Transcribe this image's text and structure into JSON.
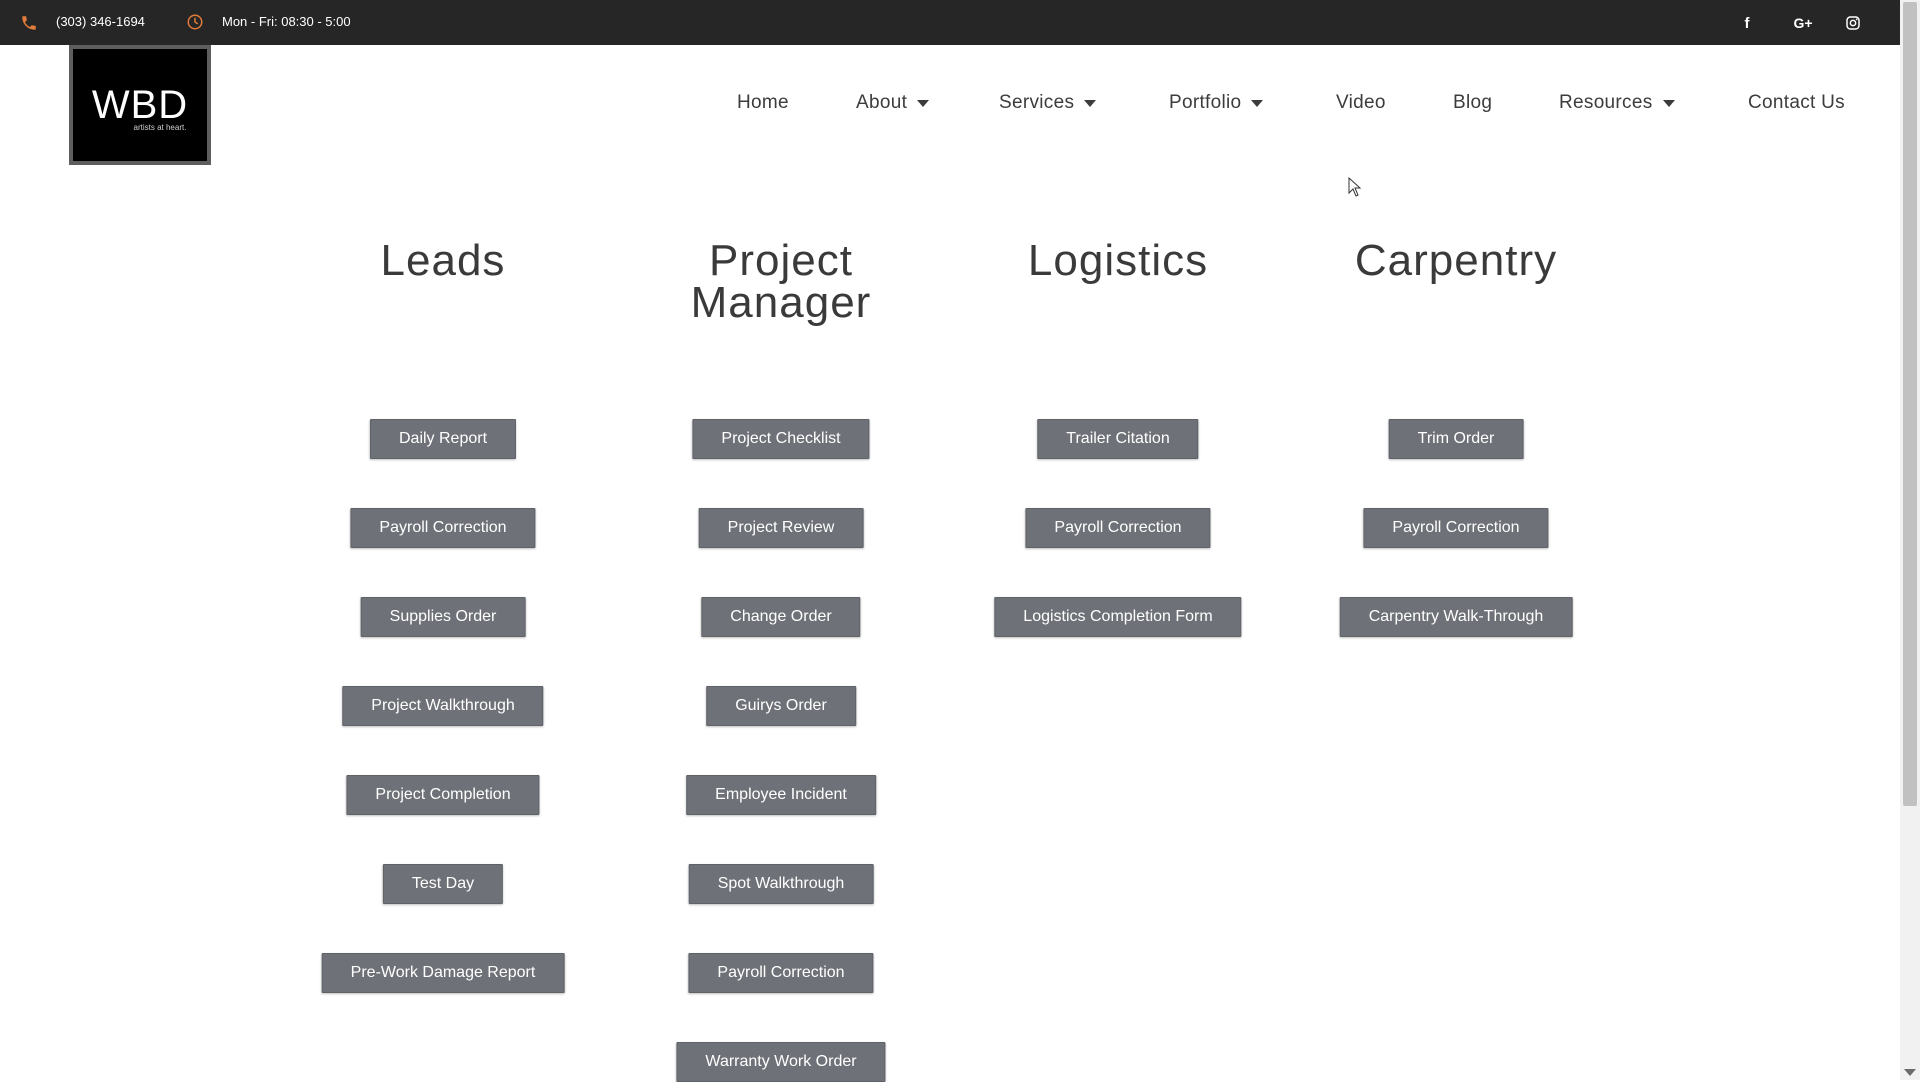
{
  "topbar": {
    "phone": "(303) 346-1694",
    "hours": "Mon - Fri: 08:30 - 5:00",
    "social": {
      "facebook": "f",
      "google_plus": "G+",
      "instagram": "instagram-icon"
    },
    "accent_color": "#e07b39"
  },
  "logo": {
    "mark": "WBD",
    "tagline": "artists at heart."
  },
  "nav": {
    "home": "Home",
    "about": "About",
    "services": "Services",
    "portfolio": "Portfolio",
    "video": "Video",
    "blog": "Blog",
    "resources": "Resources",
    "contact": "Contact Us"
  },
  "columns": [
    {
      "title": "Leads",
      "buttons": [
        "Daily Report",
        "Payroll Correction",
        "Supplies Order",
        "Project Walkthrough",
        "Project Completion",
        "Test Day",
        "Pre-Work Damage Report"
      ]
    },
    {
      "title_line1": "Project",
      "title_line2": "Manager",
      "buttons": [
        "Project Checklist",
        "Project Review",
        "Change Order",
        "Guirys Order",
        "Employee Incident",
        "Spot Walkthrough",
        "Payroll Correction",
        "Warranty Work Order"
      ]
    },
    {
      "title": "Logistics",
      "buttons": [
        "Trailer Citation",
        "Payroll Correction",
        "Logistics Completion Form"
      ]
    },
    {
      "title": "Carpentry",
      "buttons": [
        "Trim Order",
        "Payroll Correction",
        "Carpentry Walk-Through"
      ]
    }
  ],
  "button_color": "#6e7177"
}
